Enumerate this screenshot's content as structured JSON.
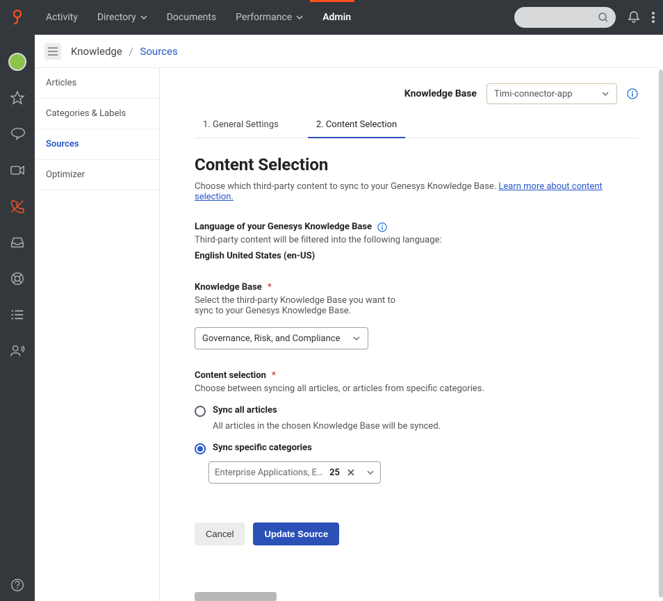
{
  "topnav": {
    "items": [
      "Activity",
      "Directory",
      "Documents",
      "Performance",
      "Admin"
    ],
    "active_index": 4
  },
  "breadcrumb": {
    "root": "Knowledge",
    "current": "Sources"
  },
  "innernav": {
    "items": [
      "Articles",
      "Categories & Labels",
      "Sources",
      "Optimizer"
    ],
    "active_index": 2
  },
  "kb_header": {
    "label": "Knowledge Base",
    "selected": "Timi-connector-app"
  },
  "step_tabs": {
    "items": [
      "1. General Settings",
      "2. Content Selection"
    ],
    "active_index": 1
  },
  "page": {
    "title": "Content Selection",
    "description": "Choose which third-party content to sync to your Genesys Knowledge Base. ",
    "learn_more": "Learn more about content selection."
  },
  "language_section": {
    "label": "Language of your Genesys Knowledge Base",
    "sub": "Third-party content will be filtered into the following language:",
    "value": "English United States (en-US)"
  },
  "kb_section": {
    "label": "Knowledge Base",
    "sub1": "Select the third-party Knowledge Base you want to",
    "sub2": "sync to your Genesys Knowledge Base.",
    "selected": "Governance, Risk, and Compliance"
  },
  "content_selection": {
    "label": "Content selection",
    "sub": "Choose between syncing all articles, or articles from specific categories.",
    "option1_label": "Sync all articles",
    "option1_help": "All articles in the chosen Knowledge Base will be synced.",
    "option2_label": "Sync specific categories",
    "categories_text": "Enterprise Applications, Enterpris…",
    "categories_count": "25"
  },
  "buttons": {
    "cancel": "Cancel",
    "update": "Update Source"
  }
}
